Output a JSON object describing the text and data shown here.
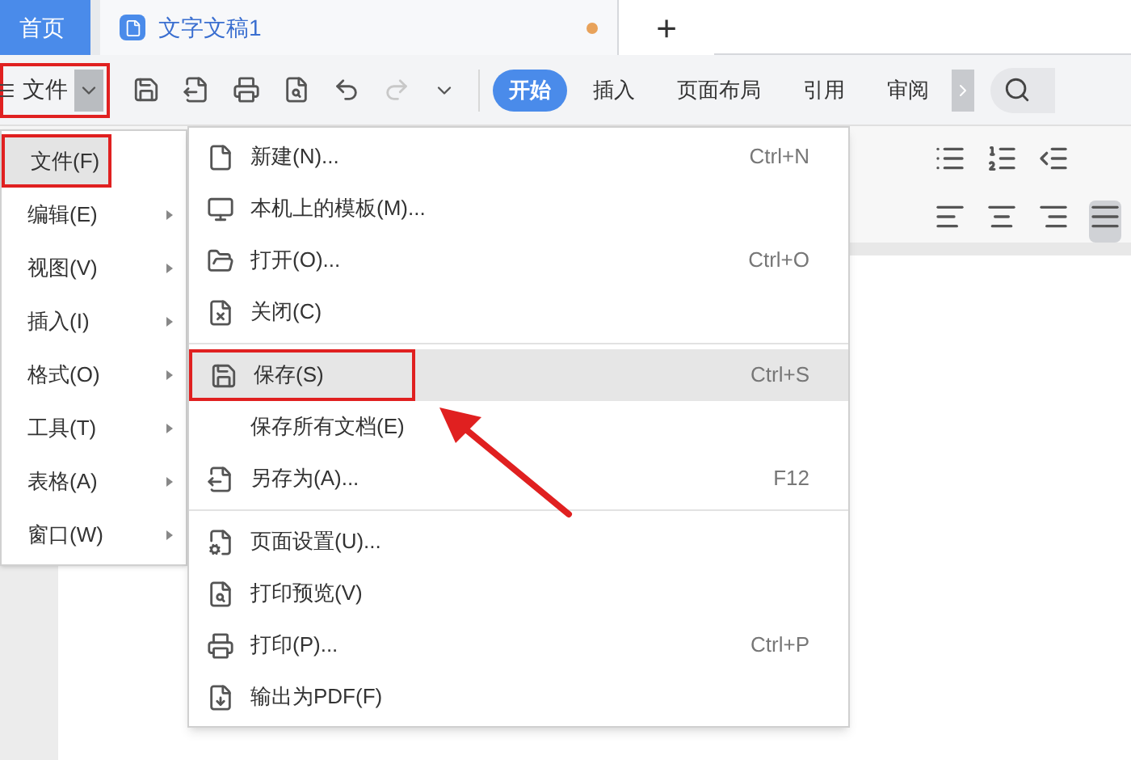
{
  "tabs": [
    {
      "label": "首页",
      "selected": true,
      "unsaved": false
    },
    {
      "label": "文字文稿1",
      "selected": false,
      "unsaved": true
    }
  ],
  "new_tab_button": "+",
  "toolbar": {
    "file_menu": {
      "label": "文件",
      "outlined": true
    },
    "undo_enabled": true,
    "redo_enabled": false,
    "ribbon_tabs": [
      {
        "label": "开始",
        "selected": true
      },
      {
        "label": "插入",
        "selected": false
      },
      {
        "label": "页面布局",
        "selected": false
      },
      {
        "label": "引用",
        "selected": false
      },
      {
        "label": "审阅",
        "selected": false
      }
    ]
  },
  "menu": {
    "items": [
      {
        "label": "文件(F)",
        "selected": true,
        "outlined": true
      },
      {
        "label": "编辑(E)",
        "selected": false,
        "outlined": false
      },
      {
        "label": "视图(V)",
        "selected": false,
        "outlined": false
      },
      {
        "label": "插入(I)",
        "selected": false,
        "outlined": false
      },
      {
        "label": "格式(O)",
        "selected": false,
        "outlined": false
      },
      {
        "label": "工具(T)",
        "selected": false,
        "outlined": false
      },
      {
        "label": "表格(A)",
        "selected": false,
        "outlined": false
      },
      {
        "label": "窗口(W)",
        "selected": false,
        "outlined": false
      }
    ]
  },
  "submenu": {
    "groups": [
      {
        "items": [
          {
            "label": "新建(N)...",
            "shortcut": "Ctrl+N",
            "selected": false,
            "outlined": false
          },
          {
            "label": "本机上的模板(M)...",
            "selected": false,
            "outlined": false
          },
          {
            "label": "打开(O)...",
            "shortcut": "Ctrl+O",
            "selected": false,
            "outlined": false
          },
          {
            "label": "关闭(C)",
            "selected": false,
            "outlined": false
          }
        ]
      },
      {
        "items": [
          {
            "label": "保存(S)",
            "shortcut": "Ctrl+S",
            "selected": true,
            "outlined": true
          },
          {
            "label": "保存所有文档(E)",
            "selected": false,
            "outlined": false
          },
          {
            "label": "另存为(A)...",
            "shortcut": "F12",
            "selected": false,
            "outlined": false
          }
        ]
      },
      {
        "items": [
          {
            "label": "页面设置(U)...",
            "selected": false,
            "outlined": false
          },
          {
            "label": "打印预览(V)",
            "selected": false,
            "outlined": false
          },
          {
            "label": "打印(P)...",
            "shortcut": "Ctrl+P",
            "selected": false,
            "outlined": false
          },
          {
            "label": "输出为PDF(F)",
            "selected": false,
            "outlined": false
          }
        ]
      }
    ]
  }
}
